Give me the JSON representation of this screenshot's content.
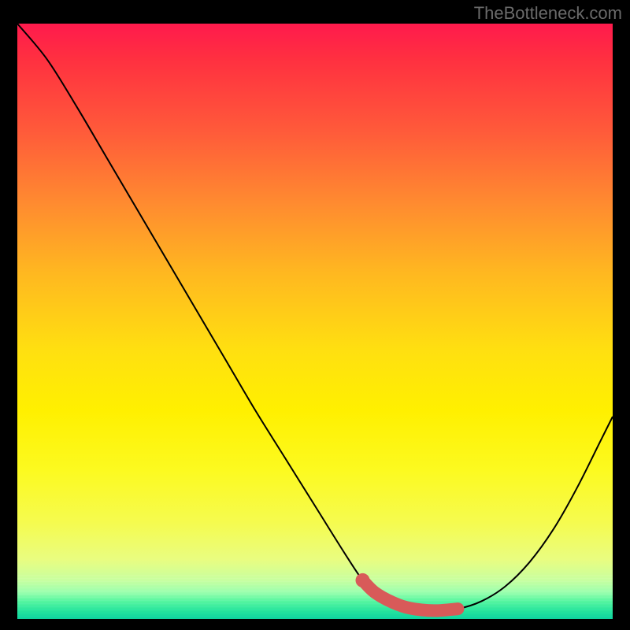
{
  "watermark": "TheBottleneck.com",
  "colors": {
    "highlight": "#d85a59",
    "curve": "#000000"
  },
  "chart_data": {
    "type": "line",
    "title": "",
    "xlabel": "",
    "ylabel": "",
    "xlim": [
      0,
      100
    ],
    "ylim": [
      0,
      100
    ],
    "grid": false,
    "legend": false,
    "series": [
      {
        "name": "bottleneck-curve",
        "x": [
          0,
          5,
          10,
          15,
          20,
          25,
          30,
          35,
          40,
          45,
          50,
          55,
          58,
          60,
          63,
          66,
          70,
          74,
          78,
          82,
          86,
          90,
          94,
          98,
          100
        ],
        "y": [
          100,
          94,
          86,
          77.5,
          69,
          60.5,
          52,
          43.5,
          35,
          27,
          19,
          11,
          6.5,
          4.5,
          2.8,
          1.8,
          1.4,
          1.7,
          3.0,
          5.5,
          9.5,
          15,
          22,
          30,
          34
        ]
      }
    ],
    "highlight": {
      "name": "optimal-range",
      "x": [
        58,
        60,
        63,
        66,
        70,
        74
      ],
      "y": [
        6.5,
        4.5,
        2.8,
        1.8,
        1.4,
        1.7
      ],
      "dot": {
        "x": 58,
        "y": 6.5
      }
    }
  }
}
